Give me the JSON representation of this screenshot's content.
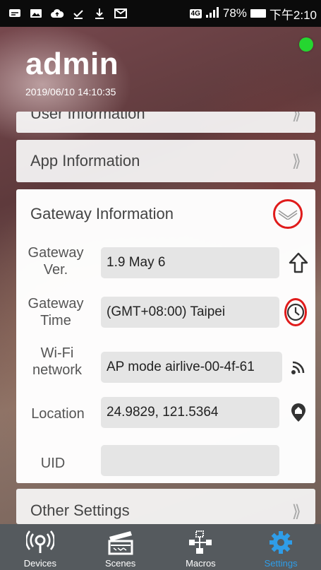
{
  "status_bar": {
    "network": "4G",
    "battery": "78%",
    "time": "下午2:10"
  },
  "header": {
    "user": "admin",
    "datetime": "2019/06/10 14:10:35",
    "online_color": "#25d630"
  },
  "sections": {
    "user_info": "User Information",
    "app_info": "App Information",
    "gateway_info": "Gateway Information",
    "other_settings": "Other Settings"
  },
  "gateway": {
    "version": {
      "label": "Gateway Ver.",
      "value": "1.9 May 6",
      "icon": "upload-arrow-icon"
    },
    "time": {
      "label": "Gateway Time",
      "value": "(GMT+08:00) Taipei",
      "icon": "clock-icon"
    },
    "wifi": {
      "label": "Wi-Fi network",
      "value": "AP mode airlive-00-4f-61",
      "icon": "wifi-signal-icon"
    },
    "location": {
      "label": "Location",
      "value": "24.9829, 121.5364",
      "icon": "location-pin-icon"
    },
    "uid": {
      "label": "UID",
      "value": ""
    }
  },
  "tabs": [
    {
      "label": "Devices",
      "icon": "devices-antenna-icon"
    },
    {
      "label": "Scenes",
      "icon": "clapperboard-icon"
    },
    {
      "label": "Macros",
      "icon": "macros-flow-icon"
    },
    {
      "label": "Settings",
      "icon": "gear-icon",
      "active": true
    }
  ],
  "colors": {
    "accent": "#2f9de8",
    "highlight_ring": "#e01b1b",
    "tab_bar": "#555a5e"
  }
}
